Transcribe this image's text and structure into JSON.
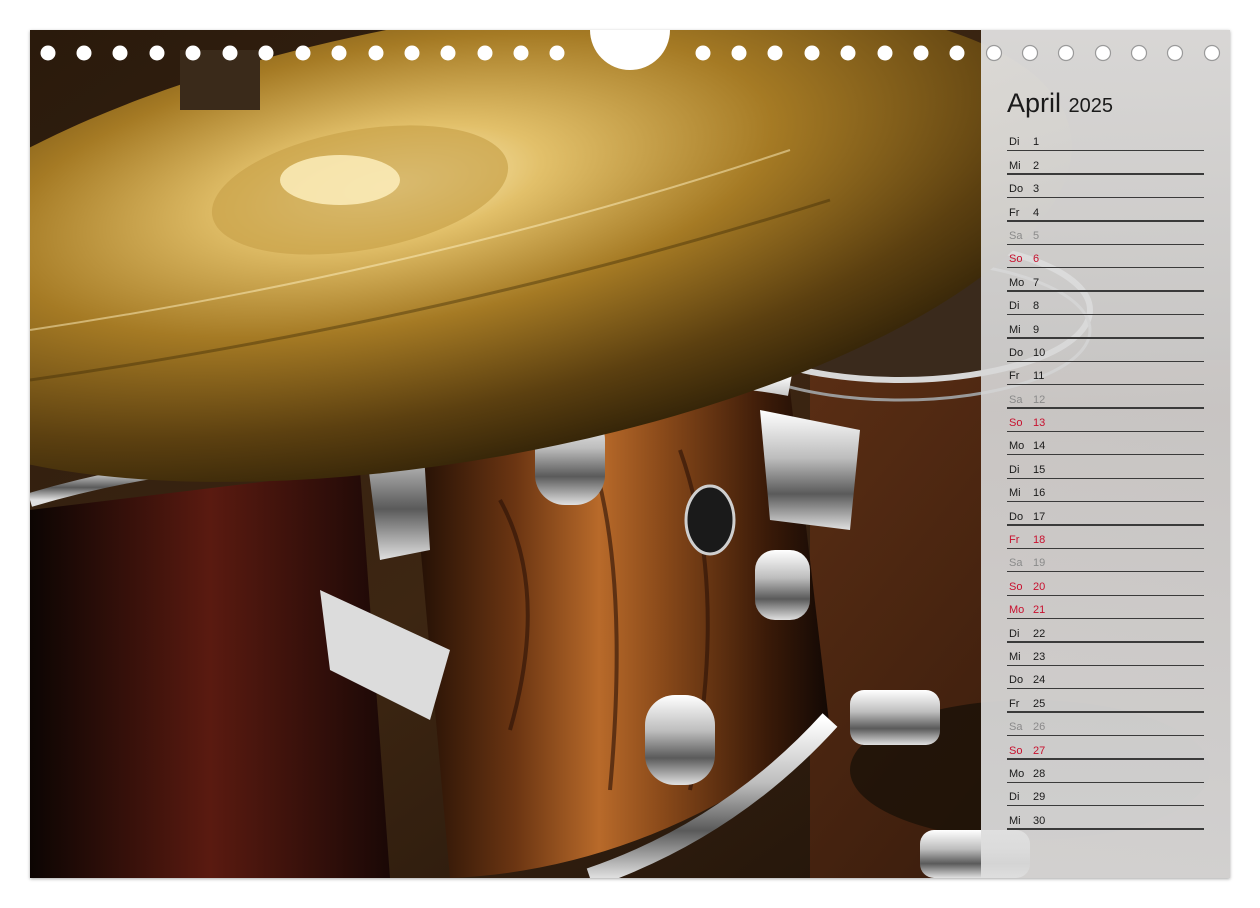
{
  "calendar": {
    "month": "April",
    "year": "2025",
    "days": [
      {
        "dow": "Di",
        "num": "1",
        "type": "weekday"
      },
      {
        "dow": "Mi",
        "num": "2",
        "type": "weekday"
      },
      {
        "dow": "Do",
        "num": "3",
        "type": "weekday"
      },
      {
        "dow": "Fr",
        "num": "4",
        "type": "weekday"
      },
      {
        "dow": "Sa",
        "num": "5",
        "type": "sat"
      },
      {
        "dow": "So",
        "num": "6",
        "type": "sun"
      },
      {
        "dow": "Mo",
        "num": "7",
        "type": "weekday"
      },
      {
        "dow": "Di",
        "num": "8",
        "type": "weekday"
      },
      {
        "dow": "Mi",
        "num": "9",
        "type": "weekday"
      },
      {
        "dow": "Do",
        "num": "10",
        "type": "weekday"
      },
      {
        "dow": "Fr",
        "num": "11",
        "type": "weekday"
      },
      {
        "dow": "Sa",
        "num": "12",
        "type": "sat"
      },
      {
        "dow": "So",
        "num": "13",
        "type": "sun"
      },
      {
        "dow": "Mo",
        "num": "14",
        "type": "weekday"
      },
      {
        "dow": "Di",
        "num": "15",
        "type": "weekday"
      },
      {
        "dow": "Mi",
        "num": "16",
        "type": "weekday"
      },
      {
        "dow": "Do",
        "num": "17",
        "type": "weekday"
      },
      {
        "dow": "Fr",
        "num": "18",
        "type": "holiday"
      },
      {
        "dow": "Sa",
        "num": "19",
        "type": "sat"
      },
      {
        "dow": "So",
        "num": "20",
        "type": "sun"
      },
      {
        "dow": "Mo",
        "num": "21",
        "type": "holiday"
      },
      {
        "dow": "Di",
        "num": "22",
        "type": "weekday"
      },
      {
        "dow": "Mi",
        "num": "23",
        "type": "weekday"
      },
      {
        "dow": "Do",
        "num": "24",
        "type": "weekday"
      },
      {
        "dow": "Fr",
        "num": "25",
        "type": "weekday"
      },
      {
        "dow": "Sa",
        "num": "26",
        "type": "sat"
      },
      {
        "dow": "So",
        "num": "27",
        "type": "sun"
      },
      {
        "dow": "Mo",
        "num": "28",
        "type": "weekday"
      },
      {
        "dow": "Di",
        "num": "29",
        "type": "weekday"
      },
      {
        "dow": "Mi",
        "num": "30",
        "type": "weekday"
      }
    ]
  },
  "colors": {
    "weekday_text": "#1a1a1a",
    "saturday_text": "#8a8a8a",
    "sunday_holiday_text": "#c8102e",
    "panel_background": "#dcdcdc",
    "cymbal_gold": "#b8902e",
    "drum_shell_brown": "#6b3512",
    "chrome": "#e8e8e8"
  },
  "photo": {
    "icon": "drum-kit-photo"
  }
}
